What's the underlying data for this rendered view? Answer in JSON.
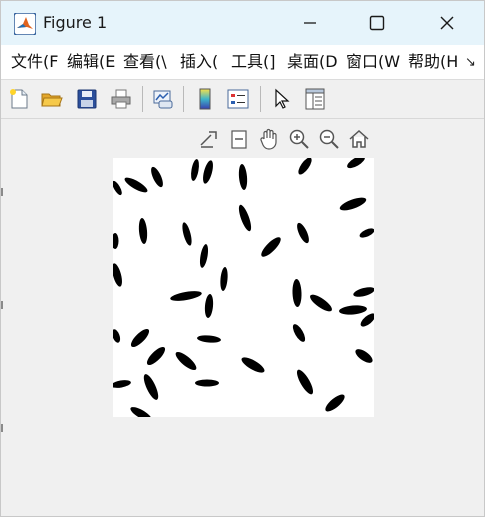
{
  "window": {
    "title": "Figure 1",
    "app_icon": "matlab-logo-icon",
    "minimize_icon": "minimize-icon",
    "maximize_icon": "maximize-icon",
    "close_icon": "close-icon"
  },
  "menu": {
    "items": [
      {
        "label": "文件(F"
      },
      {
        "label": "编辑(E"
      },
      {
        "label": "查看(\\"
      },
      {
        "label": "插入("
      },
      {
        "label": "工具(]"
      },
      {
        "label": "桌面(D"
      },
      {
        "label": "窗口(W"
      },
      {
        "label": "帮助(H"
      }
    ],
    "overflow_icon": "overflow-arrow-icon",
    "overflow_glyph": "↘"
  },
  "toolbar": {
    "buttons": [
      {
        "name": "new-figure",
        "icon": "new-file-icon"
      },
      {
        "name": "open-file",
        "icon": "folder-open-icon"
      },
      {
        "name": "save-figure",
        "icon": "floppy-disk-icon"
      },
      {
        "name": "print-figure",
        "icon": "printer-icon"
      },
      {
        "name": "link-plot",
        "icon": "link-plot-icon"
      },
      {
        "name": "insert-colorbar",
        "icon": "colorbar-icon"
      },
      {
        "name": "insert-legend",
        "icon": "legend-icon"
      },
      {
        "name": "edit-plot",
        "icon": "pointer-arrow-icon"
      },
      {
        "name": "property-inspector",
        "icon": "property-inspector-icon"
      }
    ]
  },
  "axes_toolbar": {
    "buttons": [
      {
        "name": "export",
        "icon": "export-icon"
      },
      {
        "name": "brush",
        "icon": "brush-icon"
      },
      {
        "name": "pan",
        "icon": "hand-icon"
      },
      {
        "name": "zoom-in",
        "icon": "zoom-in-icon"
      },
      {
        "name": "zoom-out",
        "icon": "zoom-out-icon"
      },
      {
        "name": "restore-view",
        "icon": "home-icon"
      }
    ]
  },
  "colors": {
    "titlebar_bg": "#e6f4fb",
    "menubar_bg": "#ffffff",
    "figure_bg": "#f0f0f0",
    "image_bg": "#ffffff",
    "grain_color": "#000000"
  }
}
